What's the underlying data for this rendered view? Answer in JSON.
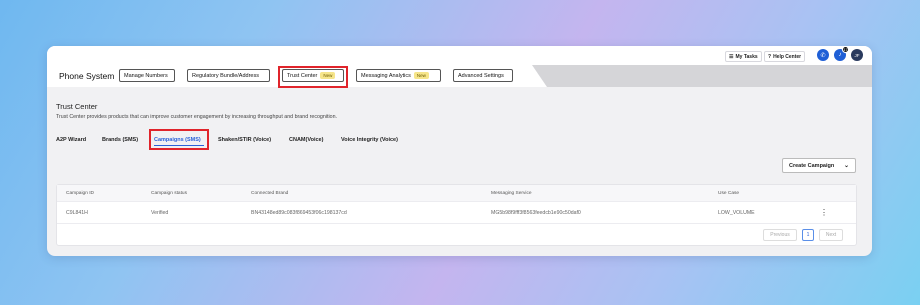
{
  "topbar": {
    "my_tasks": "My Tasks",
    "help_center": "Help Center",
    "notification_count": "17",
    "avatar_initials": "JF"
  },
  "nav": {
    "app_title": "Phone System",
    "items": [
      {
        "label": "Manage Numbers",
        "badge": ""
      },
      {
        "label": "Regulatory Bundle/Address",
        "badge": ""
      },
      {
        "label": "Trust Center",
        "badge": "New"
      },
      {
        "label": "Messaging Analytics",
        "badge": "New"
      },
      {
        "label": "Advanced Settings",
        "badge": ""
      }
    ]
  },
  "page": {
    "title": "Trust Center",
    "description": "Trust Center provides products that can improve customer engagement by increasing throughput and brand recognition."
  },
  "tabs": [
    {
      "label": "A2P Wizard",
      "active": false
    },
    {
      "label": "Brands (SMS)",
      "active": false
    },
    {
      "label": "Campaigns (SMS)",
      "active": true
    },
    {
      "label": "Shaken/STIR (Voice)",
      "active": false
    },
    {
      "label": "CNAM(Voice)",
      "active": false
    },
    {
      "label": "Voice Integrity (Voice)",
      "active": false
    }
  ],
  "create_button": {
    "label": "Create Campaign"
  },
  "table": {
    "columns": [
      "Campaign ID",
      "Campaign status",
      "Connected Brand",
      "Messaging Service",
      "Use Case"
    ],
    "rows": [
      [
        "C9L841H",
        "Verified",
        "BN43148ed89c083f869453f06c198137cd",
        "MG5b98f9fff3f8563feedcb1e90c50daf0",
        "LOW_VOLUME"
      ]
    ]
  },
  "pagination": {
    "previous": "Previous",
    "page": "1",
    "next": "Next"
  },
  "colors": {
    "accent": "#2c62d8",
    "highlight_box": "#e0242b",
    "new_badge": "#f6e58a",
    "phone_icon": "#1f5fd6"
  }
}
